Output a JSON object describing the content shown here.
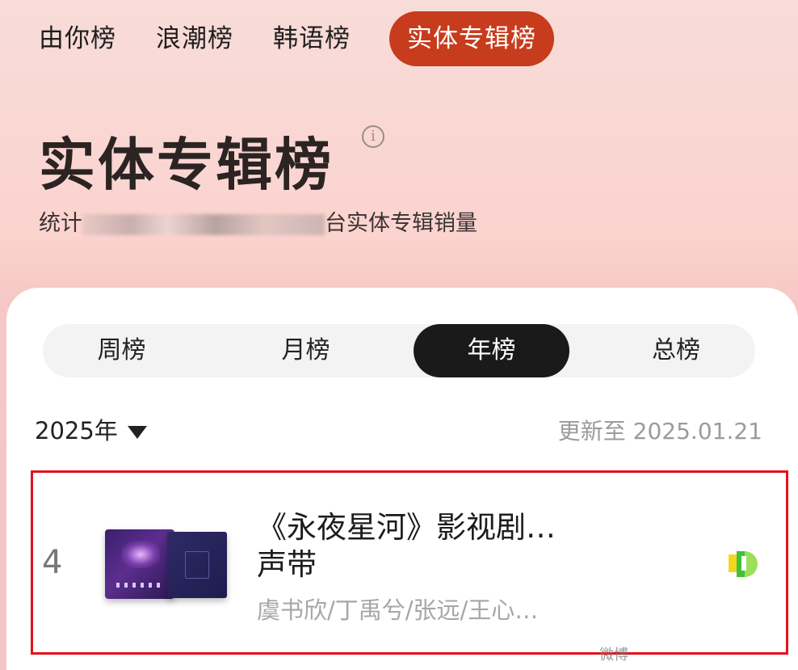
{
  "top_tabs": [
    {
      "label": "由你榜"
    },
    {
      "label": "浪潮榜"
    },
    {
      "label": "韩语榜"
    },
    {
      "label": "实体专辑榜"
    }
  ],
  "page": {
    "title": "实体专辑榜",
    "info_icon": "info-icon",
    "subtitle_prefix": "统计",
    "subtitle_suffix": "台实体专辑销量"
  },
  "period_tabs": [
    {
      "label": "周榜"
    },
    {
      "label": "月榜"
    },
    {
      "label": "年榜"
    },
    {
      "label": "总榜"
    }
  ],
  "filter": {
    "year": "2025年",
    "update_label": "更新至",
    "update_date": "2025.01.21"
  },
  "entry": {
    "rank": "4",
    "title": "《永夜星河》影视剧…",
    "title_line2": "声带",
    "artists": "虞书欣/丁禹兮/张远/王心…",
    "trend_icon": "trend-new-icon"
  },
  "watermark": {
    "text": "微博"
  },
  "colors": {
    "accent": "#c63c1d",
    "highlight_border": "#e3121a",
    "active_tab_bg": "#1a1a1a"
  }
}
